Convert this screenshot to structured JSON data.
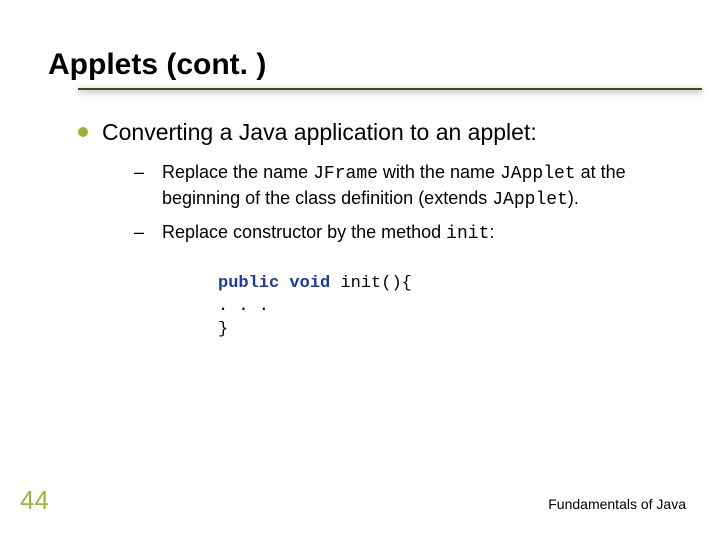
{
  "slide": {
    "title": "Applets (cont. )",
    "level1": "Converting a Java application to an applet:",
    "sub1": {
      "prefix": "Replace the name ",
      "code1": "JFrame",
      "mid1": " with the name ",
      "code2": "JApplet",
      "mid2": " at the beginning of the class definition (extends ",
      "code3": "JApplet",
      "suffix": ")."
    },
    "sub2": {
      "prefix": "Replace constructor by the method ",
      "code1": "init",
      "suffix": ":"
    },
    "code": {
      "kw_public": "public",
      "kw_void": "void",
      "sig_rest": " init(){",
      "body": ". . .",
      "close": "}"
    }
  },
  "footer": {
    "page": "44",
    "text": "Fundamentals of Java"
  }
}
